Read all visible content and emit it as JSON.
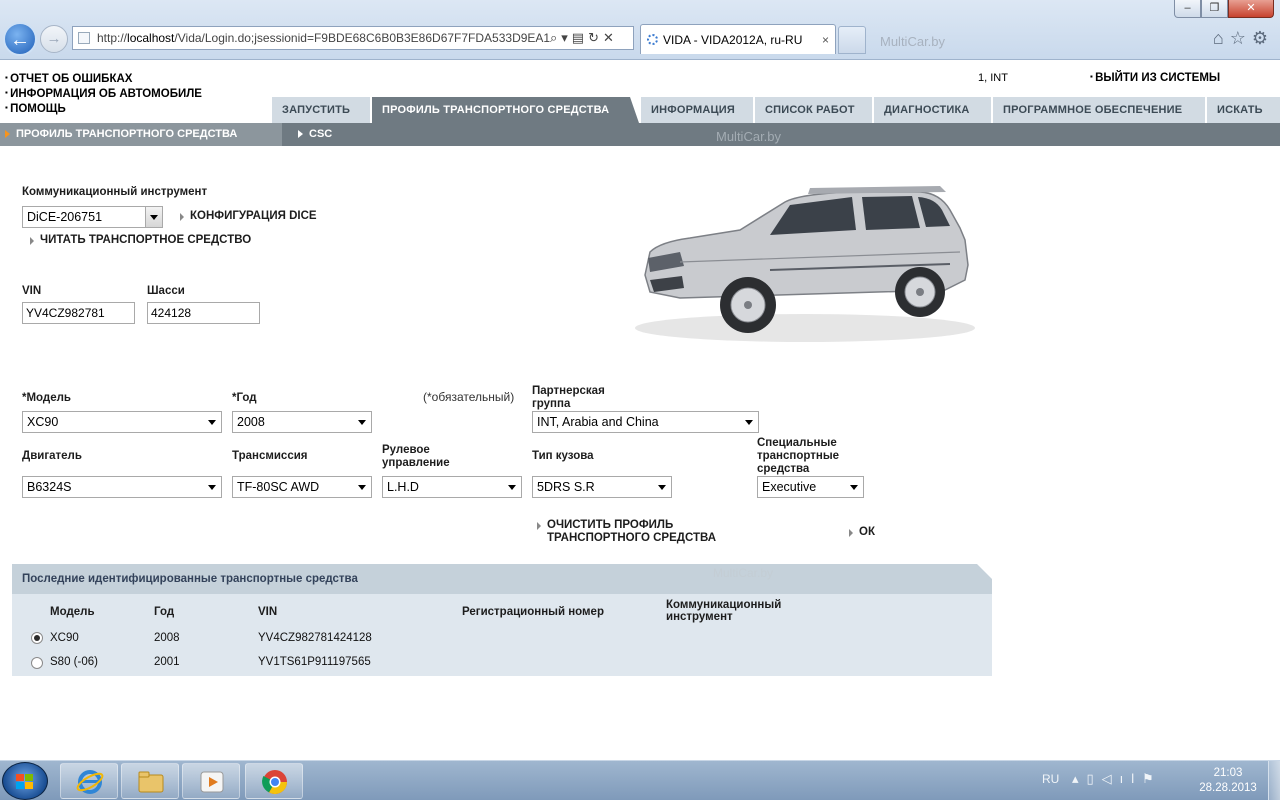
{
  "browser": {
    "url_prefix": "http://",
    "url_host": "localhost",
    "url_rest": "/Vida/Login.do;jsessionid=F9BDE68C6B0B3E86D67F7FDA533D9EA1",
    "tab_title": "VIDA - VIDA2012A, ru-RU",
    "tab_close": "×",
    "watermark": "MultiCar.by",
    "addr_icons": "⌕▾▤↻✕",
    "toolbar_icons": "⌂☆⚙",
    "back": "←",
    "forward": "→"
  },
  "header": {
    "links": [
      "ОТЧЕТ ОБ ОШИБКАХ",
      "ИНФОРМАЦИЯ ОБ АВТОМОБИЛЕ",
      "ПОМОЩЬ"
    ],
    "user": "1, INT",
    "logout": "ВЫЙТИ ИЗ СИСТЕМЫ"
  },
  "nav": {
    "tabs": [
      {
        "label": "ЗАПУСТИТЬ"
      },
      {
        "label": "ПРОФИЛЬ ТРАНСПОРТНОГО СРЕДСТВА"
      },
      {
        "label": "ИНФОРМАЦИЯ"
      },
      {
        "label": "СПИСОК РАБОТ"
      },
      {
        "label": "ДИАГНОСТИКА"
      },
      {
        "label": "ПРОГРАММНОЕ ОБЕСПЕЧЕНИЕ"
      },
      {
        "label": "ИСКАТЬ"
      }
    ],
    "sub": {
      "active": "ПРОФИЛЬ ТРАНСПОРТНОГО СРЕДСТВА",
      "csc": "CSC"
    },
    "watermark": "MultiCar.by"
  },
  "form": {
    "comm_tool_label": "Коммуникационный инструмент",
    "comm_tool_value": "DiCE-206751",
    "dice_config": "КОНФИГУРАЦИЯ DICE",
    "read_vehicle": "ЧИТАТЬ ТРАНСПОРТНОЕ  СРЕДСТВО",
    "vin_label": "VIN",
    "vin_value": "YV4CZ982781",
    "chassis_label": "Шасси",
    "chassis_value": "424128",
    "model_label": "*Модель",
    "model_value": "XC90",
    "year_label": "*Год",
    "year_value": "2008",
    "required_note": "(*обязательный)",
    "partner_label": "Партнерская группа",
    "partner_value": "INT, Arabia and China",
    "engine_label": "Двигатель",
    "engine_value": "B6324S",
    "trans_label": "Трансмиссия",
    "trans_value": "TF-80SC AWD",
    "steering_label": "Рулевое управление",
    "steering_value": "L.H.D",
    "body_label": "Тип кузова",
    "body_value": "5DRS S.R",
    "special_label": "Специальные транспортные средства",
    "special_value": "Executive",
    "clear_profile": "ОЧИСТИТЬ ПРОФИЛЬ ТРАНСПОРТНОГО СРЕДСТВА",
    "ok": "ОК"
  },
  "recent": {
    "title": "Последние идентифицированные транспортные средства",
    "watermark": "MultiCar.by",
    "columns": [
      "Модель",
      "Год",
      "VIN",
      "Регистрационный номер",
      "Коммуникационный инструмент"
    ],
    "rows": [
      {
        "model": "XC90",
        "year": "2008",
        "vin": "YV4CZ982781424128",
        "selected": true
      },
      {
        "model": "S80 (-06)",
        "year": "2001",
        "vin": "YV1TS61P911197565",
        "selected": false
      }
    ]
  },
  "taskbar": {
    "lang": "RU",
    "tray_icons": "▴▯◁ıl⚑",
    "time": "21:03",
    "date": "28.28.2013"
  }
}
